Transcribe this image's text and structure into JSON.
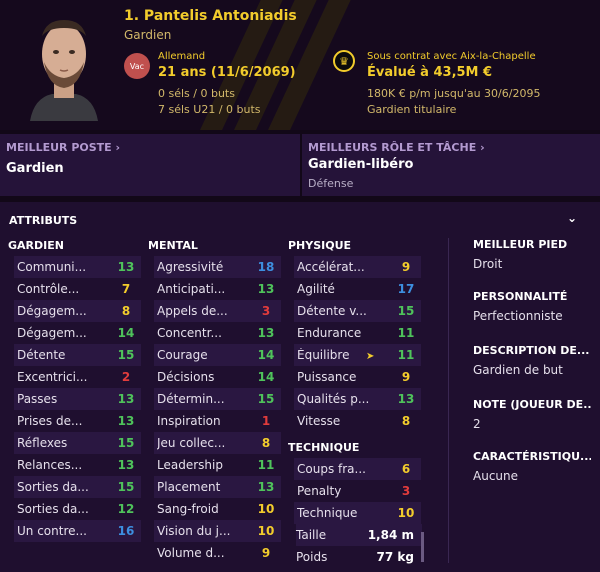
{
  "header": {
    "name": "1. Pantelis Antoniadis",
    "role": "Gardien",
    "vac_label": "Vac",
    "nationality": "Allemand",
    "age": "21 ans (11/6/2069)",
    "caps1": "0 séls / 0 buts",
    "caps2": "7 séls U21 / 0 buts",
    "contract": "Sous contrat avec Aix-la-Chapelle",
    "value": "Évalué à 43,5M €",
    "wage": "180K € p/m jusqu'au 30/6/2095",
    "status": "Gardien titulaire"
  },
  "best_position": {
    "label": "MEILLEUR POSTE",
    "value": "Gardien"
  },
  "best_role": {
    "label": "MEILLEURS RÔLE ET TÂCHE",
    "value": "Gardien-libéro",
    "duty": "Défense"
  },
  "attributes": {
    "title": "ATTRIBUTS",
    "goalkeeper": {
      "title": "GARDIEN",
      "items": [
        {
          "name": "Communi...",
          "value": "13",
          "color": "#4fc35b"
        },
        {
          "name": "Contrôle...",
          "value": "7",
          "color": "#f2cc2c"
        },
        {
          "name": "Dégagem...",
          "value": "8",
          "color": "#f2cc2c"
        },
        {
          "name": "Dégagem...",
          "value": "14",
          "color": "#4fc35b"
        },
        {
          "name": "Détente",
          "value": "15",
          "color": "#4fc35b"
        },
        {
          "name": "Excentrici...",
          "value": "2",
          "color": "#e23c3c"
        },
        {
          "name": "Passes",
          "value": "13",
          "color": "#4fc35b"
        },
        {
          "name": "Prises de...",
          "value": "13",
          "color": "#4fc35b"
        },
        {
          "name": "Réflexes",
          "value": "15",
          "color": "#4fc35b"
        },
        {
          "name": "Relances...",
          "value": "13",
          "color": "#4fc35b"
        },
        {
          "name": "Sorties da...",
          "value": "15",
          "color": "#4fc35b"
        },
        {
          "name": "Sorties da...",
          "value": "12",
          "color": "#4fc35b"
        },
        {
          "name": "Un contre...",
          "value": "16",
          "color": "#3d8fe0"
        }
      ]
    },
    "mental": {
      "title": "MENTAL",
      "items": [
        {
          "name": "Agressivité",
          "value": "18",
          "color": "#3d8fe0"
        },
        {
          "name": "Anticipati...",
          "value": "13",
          "color": "#4fc35b"
        },
        {
          "name": "Appels de...",
          "value": "3",
          "color": "#e23c3c"
        },
        {
          "name": "Concentr...",
          "value": "13",
          "color": "#4fc35b"
        },
        {
          "name": "Courage",
          "value": "14",
          "color": "#4fc35b"
        },
        {
          "name": "Décisions",
          "value": "14",
          "color": "#4fc35b"
        },
        {
          "name": "Détermin...",
          "value": "15",
          "color": "#4fc35b"
        },
        {
          "name": "Inspiration",
          "value": "1",
          "color": "#e23c3c"
        },
        {
          "name": "Jeu collec...",
          "value": "8",
          "color": "#f2cc2c"
        },
        {
          "name": "Leadership",
          "value": "11",
          "color": "#4fc35b"
        },
        {
          "name": "Placement",
          "value": "13",
          "color": "#4fc35b"
        },
        {
          "name": "Sang-froid",
          "value": "10",
          "color": "#f2cc2c"
        },
        {
          "name": "Vision du j...",
          "value": "10",
          "color": "#f2cc2c"
        },
        {
          "name": "Volume d...",
          "value": "9",
          "color": "#f2cc2c"
        }
      ]
    },
    "physical": {
      "title": "PHYSIQUE",
      "items": [
        {
          "name": "Accélérat...",
          "value": "9",
          "color": "#f2cc2c"
        },
        {
          "name": "Agilité",
          "value": "17",
          "color": "#3d8fe0"
        },
        {
          "name": "Détente v...",
          "value": "15",
          "color": "#4fc35b"
        },
        {
          "name": "Endurance",
          "value": "11",
          "color": "#4fc35b"
        },
        {
          "name": "Équilibre",
          "value": "11",
          "color": "#4fc35b"
        },
        {
          "name": "Puissance",
          "value": "9",
          "color": "#f2cc2c"
        },
        {
          "name": "Qualités p...",
          "value": "13",
          "color": "#4fc35b"
        },
        {
          "name": "Vitesse",
          "value": "8",
          "color": "#f2cc2c"
        }
      ]
    },
    "technical": {
      "title": "TECHNIQUE",
      "items": [
        {
          "name": "Coups fra...",
          "value": "6",
          "color": "#f2cc2c"
        },
        {
          "name": "Penalty",
          "value": "3",
          "color": "#e23c3c"
        },
        {
          "name": "Technique",
          "value": "10",
          "color": "#f2cc2c"
        }
      ]
    },
    "physical_stats": [
      {
        "label": "Taille",
        "value": "1,84 m"
      },
      {
        "label": "Poids",
        "value": "77 kg"
      }
    ]
  },
  "info": [
    {
      "label": "MEILLEUR PIED",
      "value": "Droit"
    },
    {
      "label": "PERSONNALITÉ",
      "value": "Perfectionniste"
    },
    {
      "label": "DESCRIPTION DE...",
      "value": "Gardien de but"
    },
    {
      "label": "NOTE (JOUEUR DE...",
      "value": "2"
    },
    {
      "label": "CARACTÉRISTIQU...",
      "value": "Aucune"
    }
  ]
}
